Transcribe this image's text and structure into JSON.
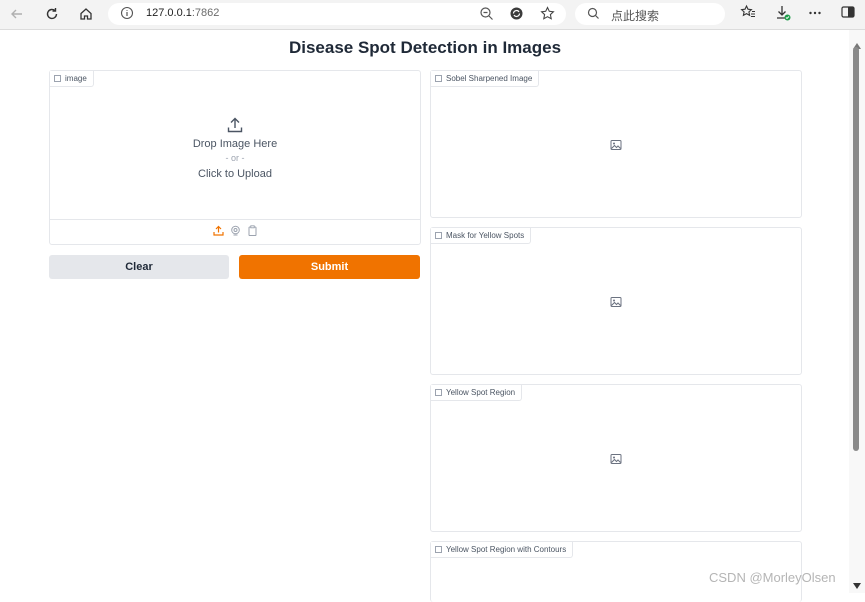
{
  "browser": {
    "url_host": "127.0.0.1",
    "url_port": ":7862",
    "search_placeholder": "点此搜索"
  },
  "page": {
    "title": "Disease Spot Detection in Images"
  },
  "input_panel": {
    "label": "image",
    "drop_text": "Drop Image Here",
    "or_text": "- or -",
    "click_text": "Click to Upload"
  },
  "buttons": {
    "clear_label": "Clear",
    "submit_label": "Submit"
  },
  "outputs": [
    {
      "label": "Sobel Sharpened Image"
    },
    {
      "label": "Mask for Yellow Spots"
    },
    {
      "label": "Yellow Spot Region"
    },
    {
      "label": "Yellow Spot Region with Contours"
    }
  ],
  "watermark": "CSDN @MorleyOlsen",
  "colors": {
    "accent": "#f07300",
    "secondary_button": "#e5e7eb",
    "border": "#e5e7eb"
  }
}
